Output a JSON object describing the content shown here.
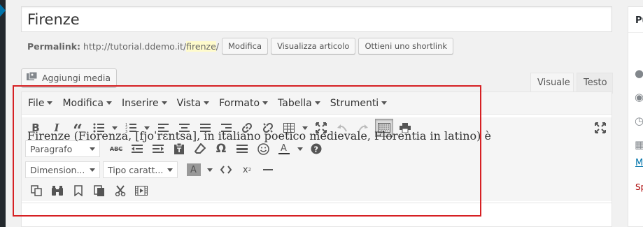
{
  "post": {
    "title": "Firenze",
    "permalink_label": "Permalink:",
    "permalink_base": "http://tutorial.ddemo.it/",
    "permalink_slug": "firenze",
    "permalink_slash": "/",
    "btn_edit": "Modifica",
    "btn_view": "Visualizza articolo",
    "btn_shortlink": "Ottieni uno shortlink"
  },
  "media": {
    "label": "Aggiungi media"
  },
  "tabs": {
    "visual": "Visuale",
    "text": "Testo"
  },
  "menubar": [
    "File",
    "Modifica",
    "Inserire",
    "Vista",
    "Formato",
    "Tabella",
    "Strumenti"
  ],
  "toolbar": {
    "format_select": "Paragrafo",
    "size_select": "Dimension...",
    "font_select": "Tipo caratt..."
  },
  "content": {
    "text": "Firenze (Fiorenza, [fjoˈrɛntsa], in italiano poetico medievale, Florentia in latino) è"
  },
  "sidebar": {
    "title": "Pu",
    "link": "M",
    "trash": "Sp"
  },
  "colors": {
    "accent": "#0073aa",
    "highlight_box": "#d62023",
    "slug_bg": "#fffbcc"
  },
  "icons": [
    "bold-icon",
    "italic-icon",
    "blockquote-icon",
    "bullet-list-icon",
    "numbered-list-icon",
    "align-left-icon",
    "align-center-icon",
    "align-justify-icon",
    "align-right-icon",
    "link-icon",
    "unlink-icon",
    "table-icon",
    "fullscreen-icon",
    "undo-icon",
    "redo-icon",
    "keyboard-icon",
    "print-icon",
    "strikethrough-icon",
    "outdent-icon",
    "indent-icon",
    "paste-text-icon",
    "clear-formatting-icon",
    "omega-icon",
    "horizontal-line-icon",
    "emoticon-icon",
    "text-color-icon",
    "help-icon",
    "background-color-icon",
    "code-icon",
    "superscript-icon",
    "hr-icon",
    "copy-icon",
    "search-replace-icon",
    "anchor-icon",
    "paste-icon",
    "cut-icon",
    "media-icon",
    "pin-icon",
    "eye-icon",
    "history-icon",
    "calendar-icon"
  ]
}
